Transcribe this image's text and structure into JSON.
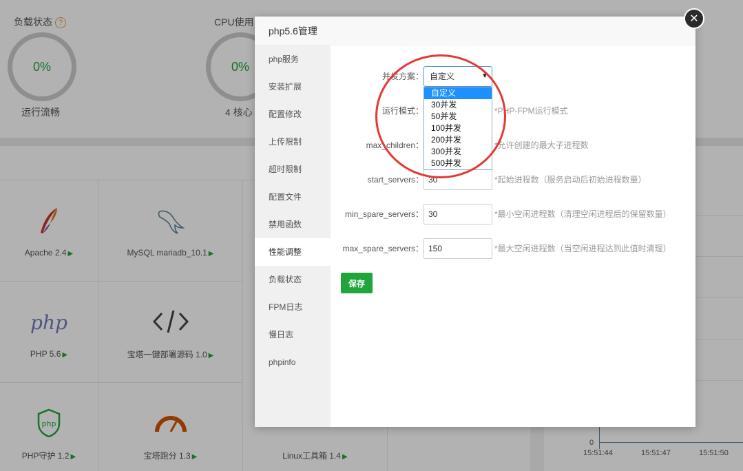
{
  "dashboard": {
    "load_title": "负载状态",
    "load_help": "?",
    "load_value": "0%",
    "load_status": "运行流畅",
    "cpu_title": "CPU使用",
    "cpu_value": "0%",
    "cpu_cores": "4 核心"
  },
  "software": [
    {
      "label": "Apache 2.4",
      "icon": "apache-feather-icon"
    },
    {
      "label": "MySQL mariadb_10.1",
      "icon": "mysql-dolphin-icon"
    },
    {
      "label": "PHP 5.6",
      "icon": "php-logo-icon"
    },
    {
      "label": "宝塔一键部署源码 1.0",
      "icon": "code-brackets-icon"
    },
    {
      "label": "PHP守护 1.2",
      "icon": "php-shield-icon"
    },
    {
      "label": "宝塔跑分 1.3",
      "icon": "speedometer-icon"
    },
    {
      "label": "Linux工具箱 1.4",
      "icon": "toolbox-icon"
    }
  ],
  "chart_data": {
    "type": "line",
    "x": [
      "15:51:44",
      "15:51:47",
      "15:51:50"
    ],
    "series": [],
    "ylim": [
      0,
      null
    ],
    "y_tick_labels": [
      "0"
    ]
  },
  "modal": {
    "title": "php5.6管理",
    "nav": [
      "php服务",
      "安装扩展",
      "配置修改",
      "上传限制",
      "超时限制",
      "配置文件",
      "禁用函数",
      "性能调整",
      "负载状态",
      "FPM日志",
      "慢日志",
      "phpinfo"
    ],
    "active_nav": "性能调整",
    "form": {
      "concurrency_label": "并发方案：",
      "concurrency_selected": "自定义",
      "concurrency_options": [
        "自定义",
        "30并发",
        "50并发",
        "100并发",
        "200并发",
        "300并发",
        "500并发"
      ],
      "run_mode_label": "运行模式：",
      "run_mode_hint": "*PHP-FPM运行模式",
      "max_children_label": "max_children：",
      "max_children_hint": "*允许创建的最大子进程数",
      "start_servers_label": "start_servers：",
      "start_servers_value": "30",
      "start_servers_hint": "*起始进程数（服务启动后初始进程数量）",
      "min_spare_label": "min_spare_servers：",
      "min_spare_value": "30",
      "min_spare_hint": "*最小空闲进程数（清理空闲进程后的保留数量）",
      "max_spare_label": "max_spare_servers：",
      "max_spare_value": "150",
      "max_spare_hint": "*最大空闲进程数（当空闲进程达到此值时清理）",
      "save_label": "保存"
    },
    "close_symbol": "✕"
  },
  "colors": {
    "accent_green": "#20a53a",
    "select_highlight": "#1e90ff",
    "annotation_red": "#e53935"
  }
}
